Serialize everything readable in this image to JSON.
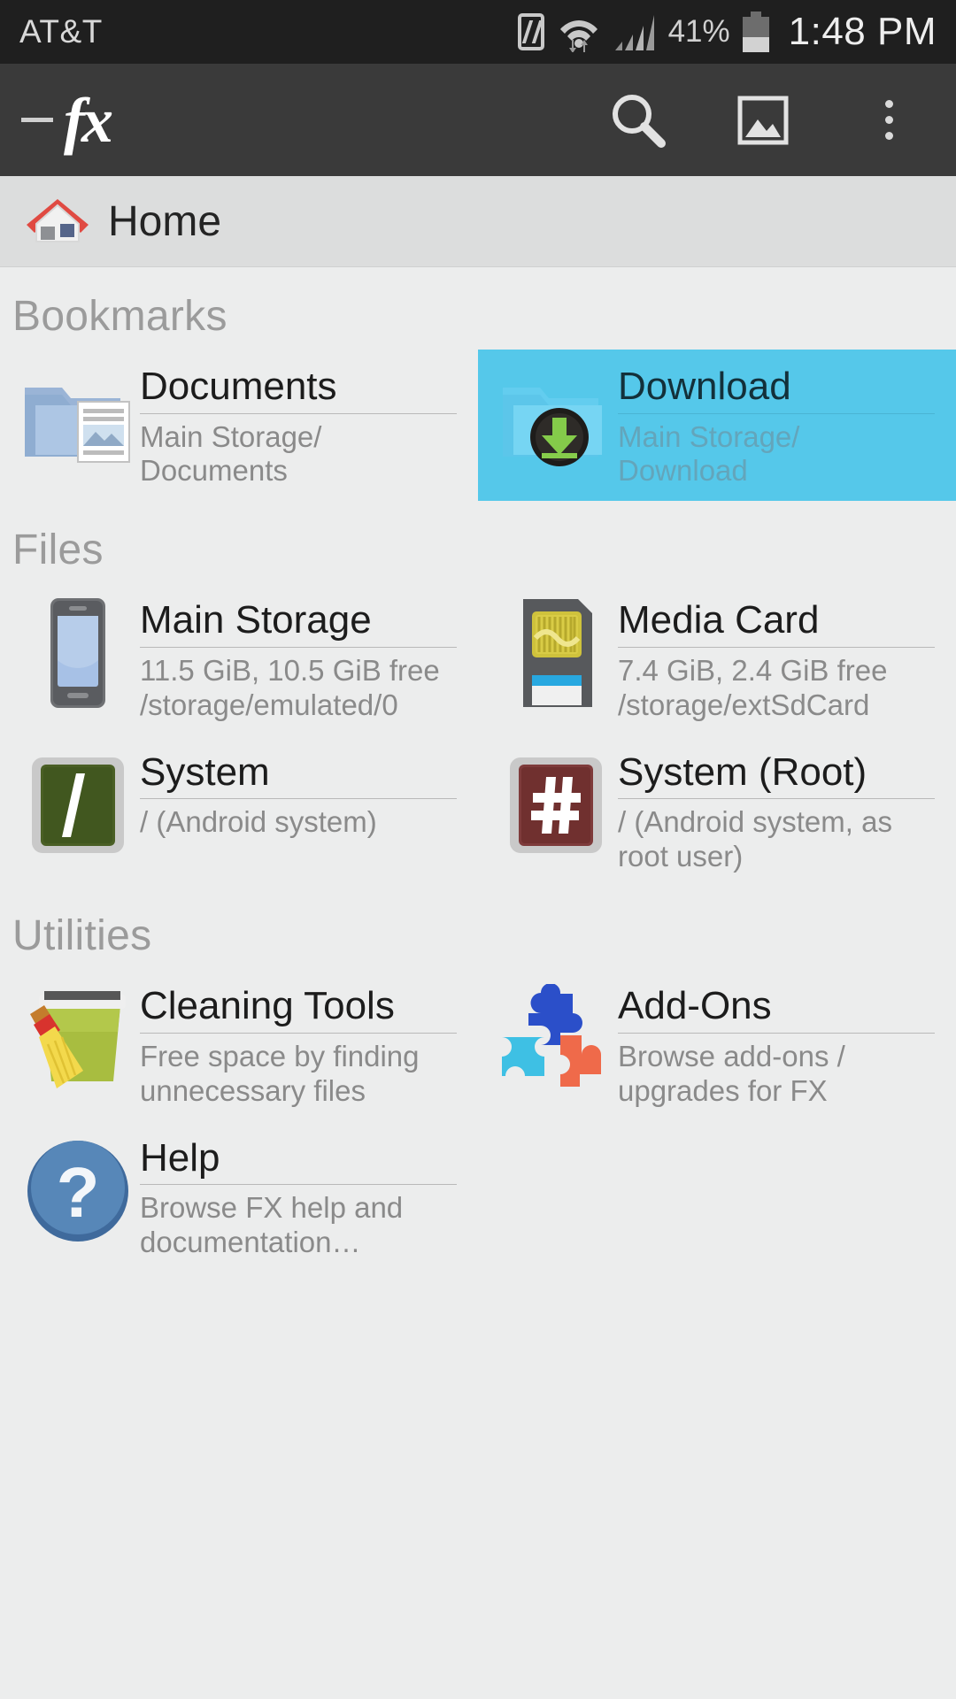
{
  "status_bar": {
    "carrier": "AT&T",
    "battery_percent": "41%",
    "time": "1:48 PM",
    "icons": [
      "nfc-icon",
      "wifi-icon",
      "cell-signal-icon",
      "battery-icon"
    ]
  },
  "app_bar": {
    "logo": "fx",
    "actions": [
      {
        "name": "search-icon",
        "label": "Search"
      },
      {
        "name": "image-gallery-icon",
        "label": "Images"
      },
      {
        "name": "overflow-menu-icon",
        "label": "More options"
      }
    ]
  },
  "breadcrumb": {
    "icon": "home-icon",
    "label": "Home"
  },
  "sections": [
    {
      "title": "Bookmarks",
      "items": [
        {
          "title": "Documents",
          "subtitle": "Main Storage/ Documents",
          "icon": "folder-documents-icon",
          "selected": false
        },
        {
          "title": "Download",
          "subtitle": "Main Storage/ Download",
          "icon": "folder-download-icon",
          "selected": true
        }
      ]
    },
    {
      "title": "Files",
      "items": [
        {
          "title": "Main Storage",
          "subtitle": "11.5 GiB, 10.5 GiB free /storage/emulated/0",
          "icon": "phone-icon",
          "selected": false
        },
        {
          "title": "Media Card",
          "subtitle": "7.4 GiB, 2.4 GiB free /storage/extSdCard",
          "icon": "sd-card-icon",
          "selected": false
        },
        {
          "title": "System",
          "subtitle": "/ (Android system)",
          "icon": "root-slash-icon",
          "selected": false
        },
        {
          "title": "System (Root)",
          "subtitle": "/ (Android system, as root user)",
          "icon": "root-hash-icon",
          "selected": false
        }
      ]
    },
    {
      "title": "Utilities",
      "items": [
        {
          "title": "Cleaning Tools",
          "subtitle": "Free space by finding unnecessary files",
          "icon": "broom-bin-icon",
          "selected": false
        },
        {
          "title": "Add-Ons",
          "subtitle": "Browse add-ons / upgrades for FX",
          "icon": "puzzle-icon",
          "selected": false
        },
        {
          "title": "Help",
          "subtitle": "Browse FX help and documentation…",
          "icon": "question-mark-icon",
          "selected": false
        }
      ]
    }
  ],
  "colors": {
    "status_bar_bg": "#1f1f1f",
    "app_bar_bg": "#3a3a3a",
    "crumb_bg": "#dcdddd",
    "page_bg": "#eceded",
    "selection": "#55c8ea",
    "section_title": "#9b9b9b",
    "subtitle": "#8a8a8a"
  }
}
